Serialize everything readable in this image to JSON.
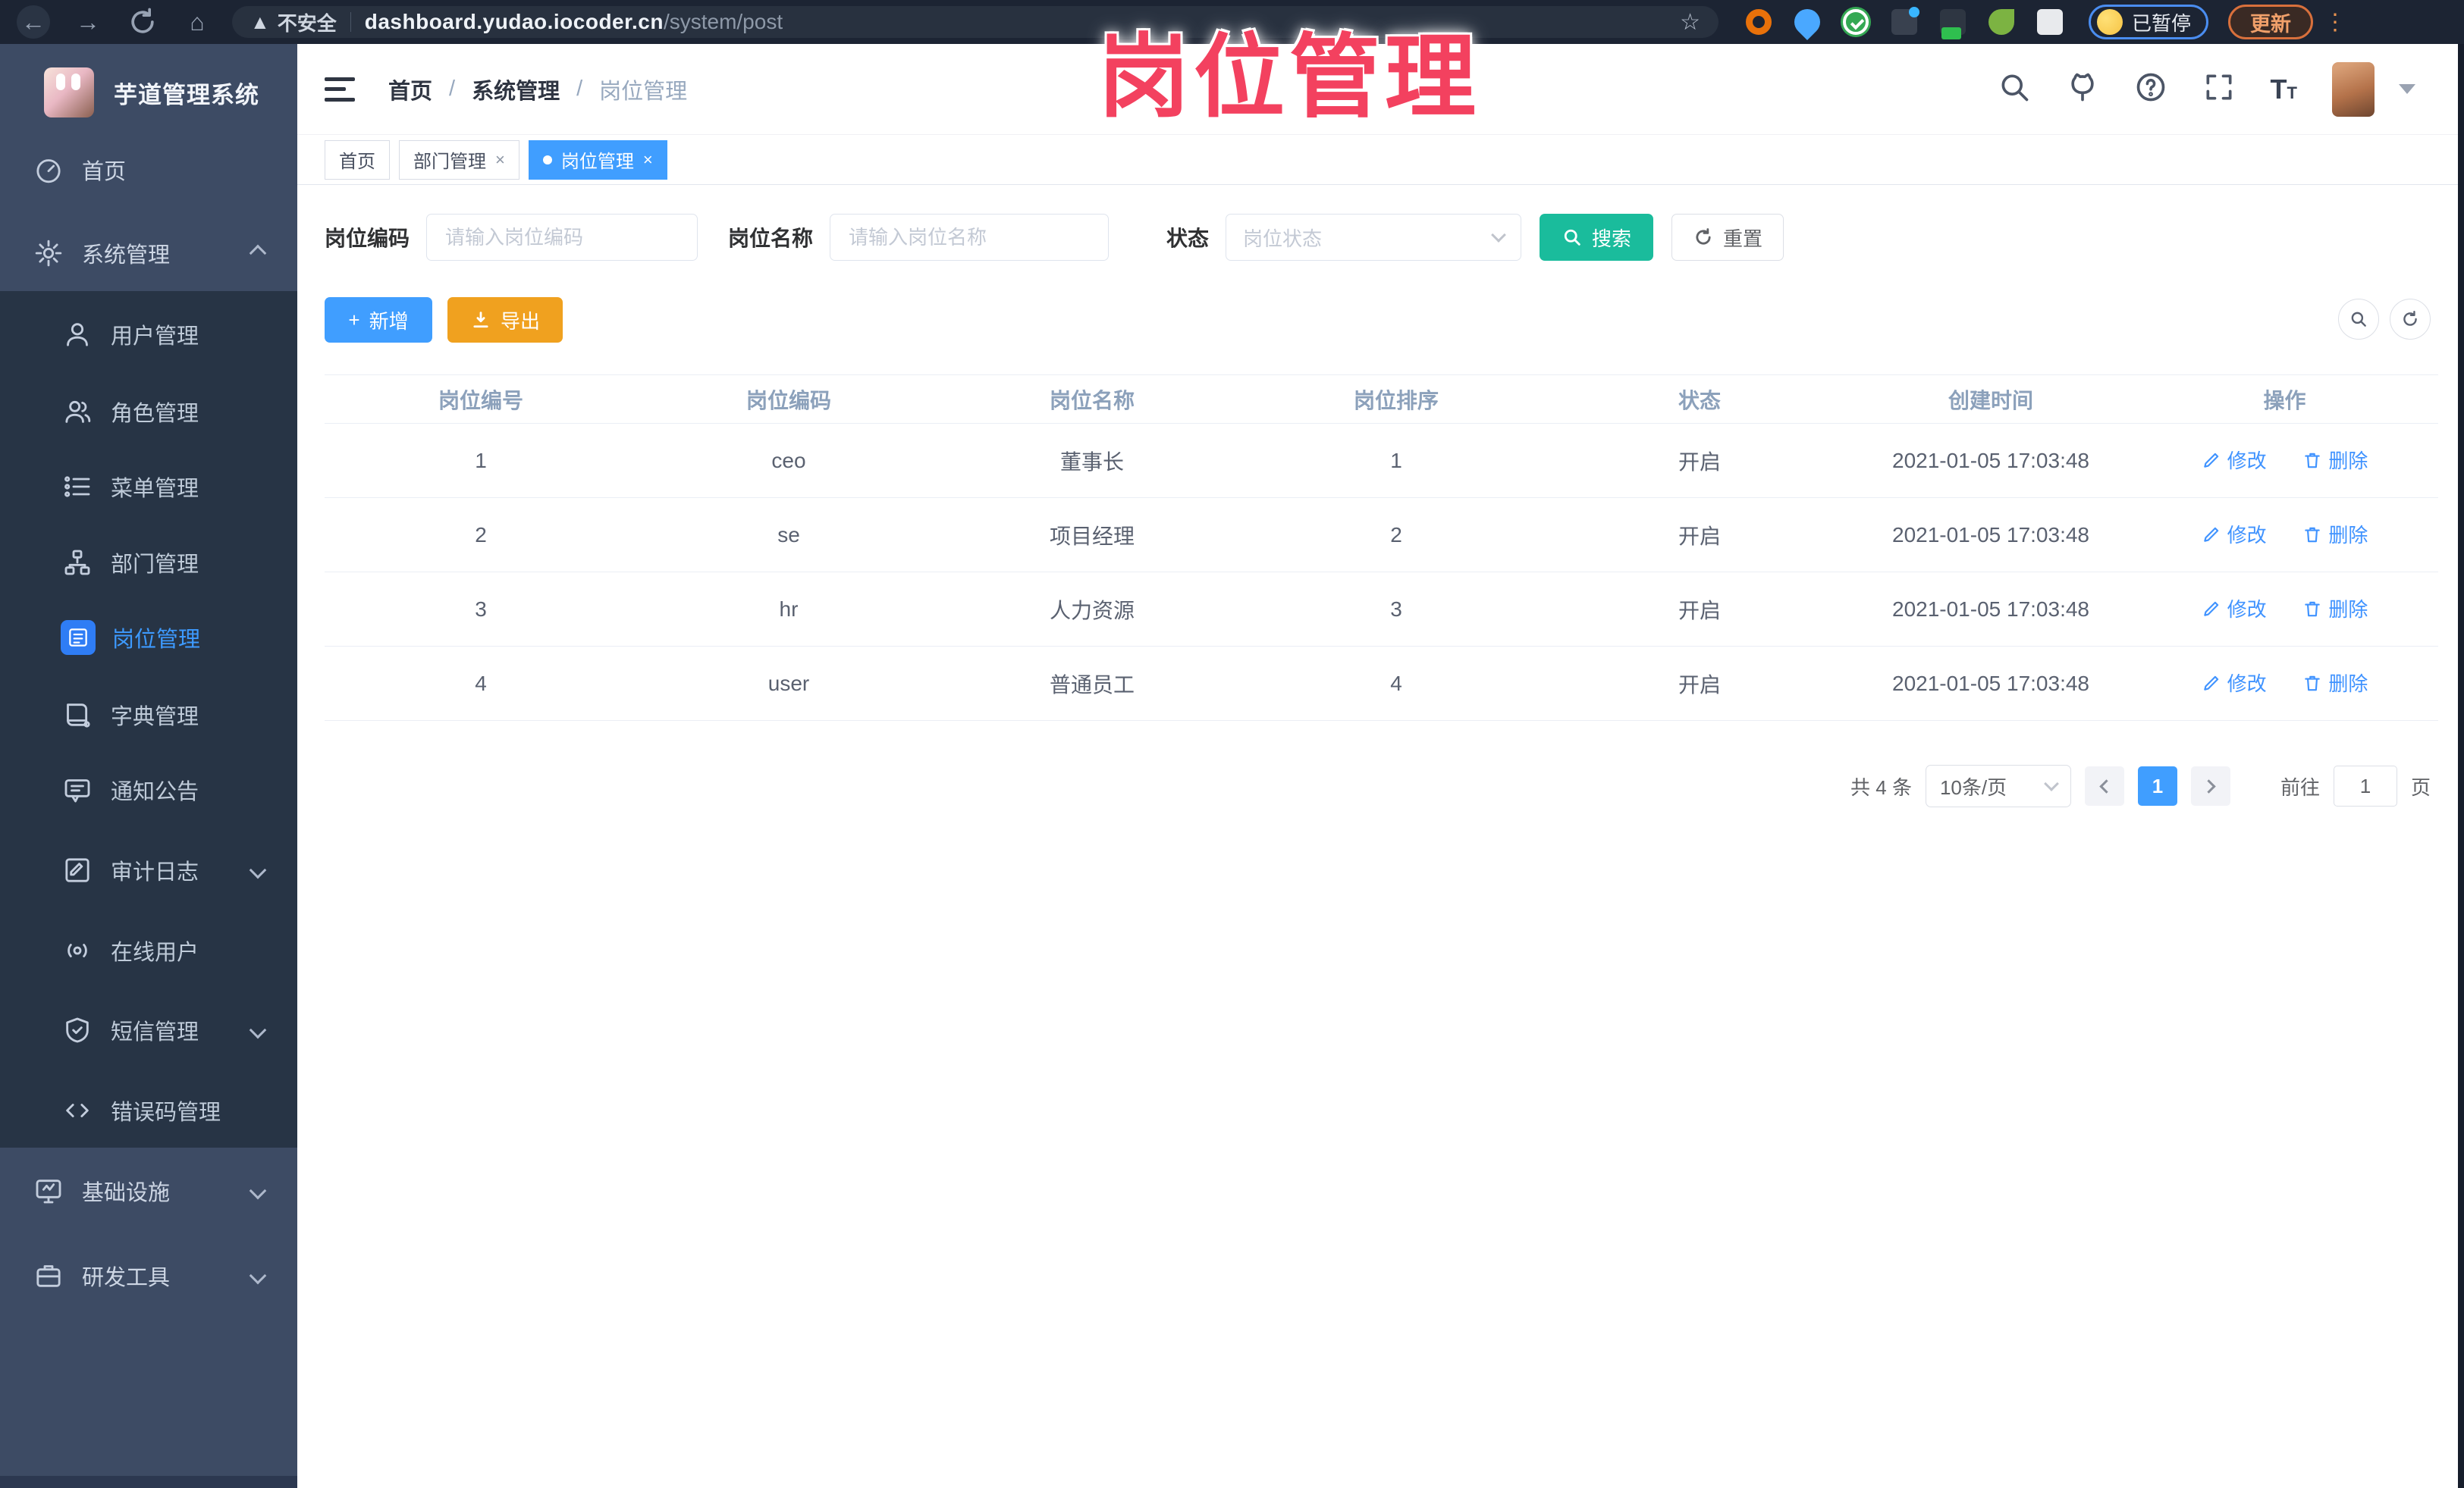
{
  "colors": {
    "primary": "#409eff",
    "search_button": "#1abc9c",
    "export_button": "#f0a11f",
    "overlay_annotation": "#f3415f",
    "sidebar_bg": "#3d4b64",
    "sidebar_submenu_bg": "#273445",
    "browser_bar_bg": "#1c2433"
  },
  "annotation": {
    "title": "岗位管理"
  },
  "browser": {
    "security_label": "不安全",
    "url_domain": "dashboard.yudao.iocoder.cn",
    "url_path": "/system/post",
    "paused_badge": "已暂停",
    "update_button": "更新",
    "icons": [
      "back-icon",
      "forward-icon",
      "reload-icon",
      "home-icon",
      "warning-icon",
      "bookmark-star-icon",
      "extension-icons",
      "kebab-menu-icon"
    ]
  },
  "sidebar": {
    "title": "芋道管理系统",
    "items_top": [
      {
        "label": "首页",
        "icon": "dashboard-icon"
      },
      {
        "label": "系统管理",
        "icon": "gear-icon",
        "state": "expanded"
      }
    ],
    "items_sub": [
      {
        "label": "用户管理",
        "icon": "user-icon"
      },
      {
        "label": "角色管理",
        "icon": "role-icon"
      },
      {
        "label": "菜单管理",
        "icon": "menu-list-icon"
      },
      {
        "label": "部门管理",
        "icon": "org-tree-icon"
      },
      {
        "label": "岗位管理",
        "icon": "post-badge-icon",
        "state": "active"
      },
      {
        "label": "字典管理",
        "icon": "dict-book-icon"
      },
      {
        "label": "通知公告",
        "icon": "notice-chat-icon"
      },
      {
        "label": "审计日志",
        "icon": "audit-log-icon",
        "state": "collapsible"
      },
      {
        "label": "在线用户",
        "icon": "online-user-icon"
      },
      {
        "label": "短信管理",
        "icon": "sms-shield-icon",
        "state": "collapsible"
      },
      {
        "label": "错误码管理",
        "icon": "error-code-icon"
      }
    ],
    "items_bottom": [
      {
        "label": "基础设施",
        "icon": "infra-monitor-icon",
        "state": "collapsible"
      },
      {
        "label": "研发工具",
        "icon": "dev-tools-icon",
        "state": "collapsible"
      }
    ]
  },
  "header": {
    "breadcrumb": [
      "首页",
      "系统管理",
      "岗位管理"
    ],
    "separator": "/",
    "icons": [
      "search-icon",
      "github-icon",
      "help-icon",
      "fullscreen-icon",
      "font-size-icon",
      "avatar",
      "caret-down-icon"
    ]
  },
  "tabs": [
    {
      "label": "首页",
      "closable": false,
      "active": false
    },
    {
      "label": "部门管理",
      "closable": true,
      "active": false
    },
    {
      "label": "岗位管理",
      "closable": true,
      "active": true
    }
  ],
  "tab_close": "×",
  "filters": {
    "code_label": "岗位编码",
    "code_placeholder": "请输入岗位编码",
    "name_label": "岗位名称",
    "name_placeholder": "请输入岗位名称",
    "status_label": "状态",
    "status_placeholder": "岗位状态",
    "search_label": "搜索",
    "reset_label": "重置"
  },
  "toolbar": {
    "add_label": "新增",
    "add_plus": "+",
    "export_label": "导出"
  },
  "table": {
    "columns": [
      "岗位编号",
      "岗位编码",
      "岗位名称",
      "岗位排序",
      "状态",
      "创建时间",
      "操作"
    ],
    "actions": {
      "edit": "修改",
      "delete": "删除"
    },
    "rows": [
      {
        "id": "1",
        "code": "ceo",
        "name": "董事长",
        "sort": "1",
        "status": "开启",
        "created": "2021-01-05 17:03:48"
      },
      {
        "id": "2",
        "code": "se",
        "name": "项目经理",
        "sort": "2",
        "status": "开启",
        "created": "2021-01-05 17:03:48"
      },
      {
        "id": "3",
        "code": "hr",
        "name": "人力资源",
        "sort": "3",
        "status": "开启",
        "created": "2021-01-05 17:03:48"
      },
      {
        "id": "4",
        "code": "user",
        "name": "普通员工",
        "sort": "4",
        "status": "开启",
        "created": "2021-01-05 17:03:48"
      }
    ]
  },
  "pagination": {
    "total": "共 4 条",
    "page_size": "10条/页",
    "current_page": "1",
    "goto_label": "前往",
    "goto_value": "1",
    "page_unit": "页"
  }
}
